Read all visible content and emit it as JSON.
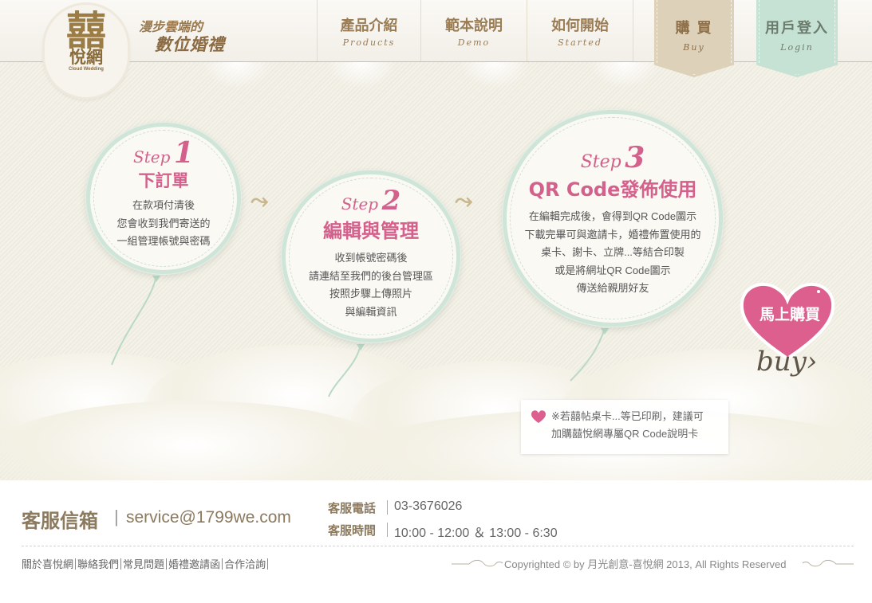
{
  "header": {
    "logo": {
      "char": "囍",
      "name": "悅網",
      "sub": "Cloud Wedding"
    },
    "tagline_1": "漫步雲端的",
    "tagline_2": "數位婚禮",
    "nav": [
      {
        "cn": "產品介紹",
        "en": "Products"
      },
      {
        "cn": "範本說明",
        "en": "Demo"
      },
      {
        "cn": "如何開始",
        "en": "Started"
      }
    ],
    "buy": {
      "cn": "購 買",
      "en": "Buy"
    },
    "login": {
      "cn": "用戶登入",
      "en": "Login"
    }
  },
  "steps": [
    {
      "word": "Step",
      "num": "1",
      "title": "下訂單",
      "lines": [
        "在款項付清後",
        "您會收到我們寄送的",
        "一組管理帳號與密碼"
      ]
    },
    {
      "word": "Step",
      "num": "2",
      "title": "編輯與管理",
      "lines": [
        "收到帳號密碼後",
        "請連結至我們的後台管理區",
        "按照步驟上傳照片",
        "與編輯資訊"
      ]
    },
    {
      "word": "Step",
      "num": "3",
      "title": "QR Code發佈使用",
      "lines": [
        "在編輯完成後，會得到QR Code圖示",
        "下載完畢可與邀請卡，婚禮佈置使用的",
        "桌卡、謝卡、立牌...等結合印製",
        "或是將網址QR Code圖示",
        "傳送給親朋好友"
      ]
    }
  ],
  "buy_now": {
    "label": "馬上購買",
    "script": "buy›"
  },
  "note": {
    "line_1": "※若囍帖桌卡...等已印刷，建議可",
    "line_2": "加購囍悅網專屬QR Code說明卡"
  },
  "footer": {
    "mail_label": "客服信箱",
    "mail_sep": "|",
    "mail": "service@1799we.com",
    "tel_label": "客服電話",
    "tel": "03-3676026",
    "hours_label": "客服時間",
    "hours": "10:00 - 12:00 ＆ 13:00 - 6:30",
    "links": [
      "關於喜悅網",
      "聯絡我們",
      "常見問題",
      "婚禮邀請函",
      "合作洽詢"
    ],
    "copyright": "Copyrighted © by 月光創意-喜悅網 2013, All Rights Reserved"
  },
  "colors": {
    "pink": "#d4608c",
    "mint": "#cfe5d8",
    "gold": "#9a7c55",
    "heart": "#dc5f8d"
  }
}
